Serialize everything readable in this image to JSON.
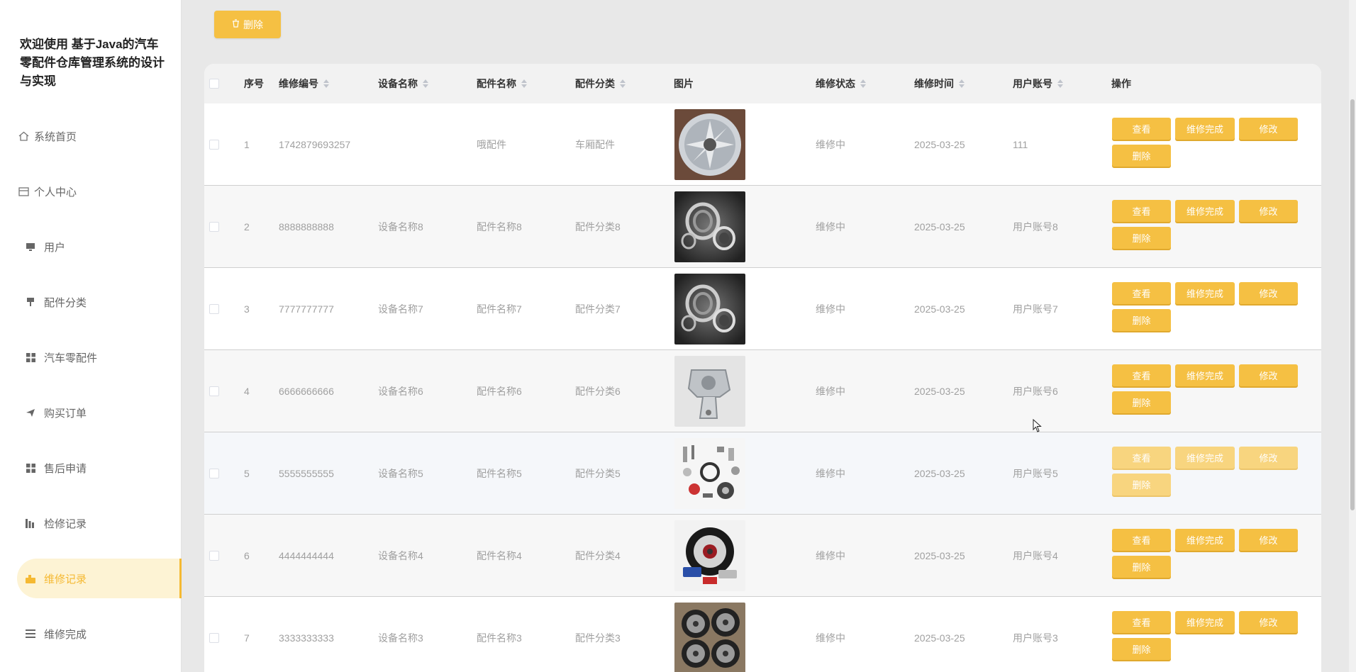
{
  "app": {
    "title": "欢迎使用 基于Java的汽车零配件仓库管理系统的设计与实现"
  },
  "sidebar": {
    "items": [
      {
        "label": "系统首页",
        "icon": "home-icon"
      },
      {
        "label": "个人中心",
        "icon": "id-card-icon"
      },
      {
        "label": "用户",
        "icon": "monitor-icon"
      },
      {
        "label": "配件分类",
        "icon": "pin-icon"
      },
      {
        "label": "汽车零配件",
        "icon": "grid-icon"
      },
      {
        "label": "购买订单",
        "icon": "send-icon"
      },
      {
        "label": "售后申请",
        "icon": "grid-icon"
      },
      {
        "label": "检修记录",
        "icon": "chart-icon"
      },
      {
        "label": "维修记录",
        "icon": "hand-icon",
        "active": true
      },
      {
        "label": "维修完成",
        "icon": "list-icon"
      }
    ]
  },
  "toolbar": {
    "delete_label": "删除"
  },
  "table": {
    "headers": {
      "index": "序号",
      "code": "维修编号",
      "device": "设备名称",
      "part": "配件名称",
      "category": "配件分类",
      "image": "图片",
      "status": "维修状态",
      "time": "维修时间",
      "account": "用户账号",
      "ops": "操作"
    },
    "actions": {
      "view": "查看",
      "complete": "维修完成",
      "edit": "修改",
      "delete": "删除"
    },
    "rows": [
      {
        "index": "1",
        "code": "1742879693257",
        "device": "",
        "part": "哦配件",
        "category": "车厢配件",
        "image": "wheel-rim",
        "status": "维修中",
        "time": "2025-03-25",
        "account": "111"
      },
      {
        "index": "2",
        "code": "8888888888",
        "device": "设备名称8",
        "part": "配件名称8",
        "category": "配件分类8",
        "image": "bearing",
        "status": "维修中",
        "time": "2025-03-25",
        "account": "用户账号8"
      },
      {
        "index": "3",
        "code": "7777777777",
        "device": "设备名称7",
        "part": "配件名称7",
        "category": "配件分类7",
        "image": "bearing",
        "status": "维修中",
        "time": "2025-03-25",
        "account": "用户账号7"
      },
      {
        "index": "4",
        "code": "6666666666",
        "device": "设备名称6",
        "part": "配件名称6",
        "category": "配件分类6",
        "image": "engine-mount",
        "status": "维修中",
        "time": "2025-03-25",
        "account": "用户账号6"
      },
      {
        "index": "5",
        "code": "5555555555",
        "device": "设备名称5",
        "part": "配件名称5",
        "category": "配件分类5",
        "image": "parts-collection",
        "status": "维修中",
        "time": "2025-03-25",
        "account": "用户账号5"
      },
      {
        "index": "6",
        "code": "4444444444",
        "device": "设备名称4",
        "part": "配件名称4",
        "category": "配件分类4",
        "image": "brake-wheel",
        "status": "维修中",
        "time": "2025-03-25",
        "account": "用户账号4"
      },
      {
        "index": "7",
        "code": "3333333333",
        "device": "设备名称3",
        "part": "配件名称3",
        "category": "配件分类3",
        "image": "alloy-wheels",
        "status": "维修中",
        "time": "2025-03-25",
        "account": "用户账号3"
      }
    ]
  },
  "colors": {
    "accent": "#f5c043",
    "active_bg": "#fdf3d4"
  }
}
